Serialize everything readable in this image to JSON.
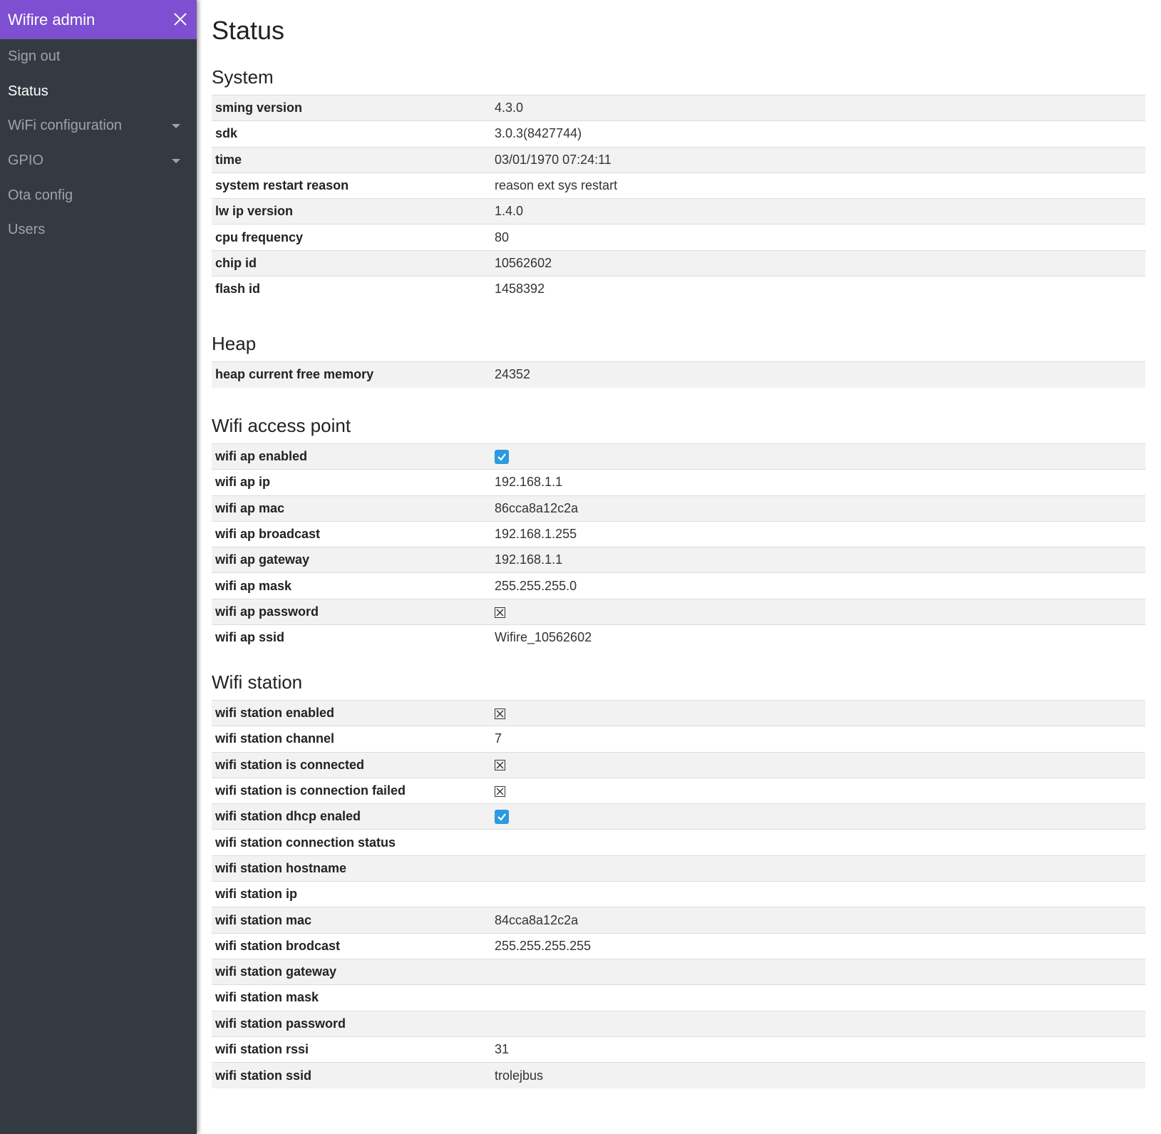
{
  "sidebar": {
    "title": "Wifire admin",
    "items": [
      {
        "label": "Sign out",
        "active": false,
        "has_caret": false
      },
      {
        "label": "Status",
        "active": true,
        "has_caret": false
      },
      {
        "label": "WiFi configuration",
        "active": false,
        "has_caret": true
      },
      {
        "label": "GPIO",
        "active": false,
        "has_caret": true
      },
      {
        "label": "Ota config",
        "active": false,
        "has_caret": false
      },
      {
        "label": "Users",
        "active": false,
        "has_caret": false
      }
    ]
  },
  "colors": {
    "header_accent": "#7e4fd0",
    "sidebar_bg": "#333a41",
    "check_yes": "#2b9ae0"
  },
  "page": {
    "title": "Status"
  },
  "sections": [
    {
      "title": "System",
      "rows": [
        {
          "key": "sming version",
          "value": "4.3.0"
        },
        {
          "key": "sdk",
          "value": "3.0.3(8427744)"
        },
        {
          "key": "time",
          "value": "03/01/1970 07:24:11"
        },
        {
          "key": "system restart reason",
          "value": "reason ext sys restart"
        },
        {
          "key": "lw ip version",
          "value": "1.4.0"
        },
        {
          "key": "cpu frequency",
          "value": "80"
        },
        {
          "key": "chip id",
          "value": "10562602"
        },
        {
          "key": "flash id",
          "value": "1458392"
        }
      ]
    },
    {
      "title": "Heap",
      "rows": [
        {
          "key": "heap current free memory",
          "value": "24352"
        }
      ]
    },
    {
      "title": "Wifi access point",
      "rows": [
        {
          "key": "wifi ap enabled",
          "bool": true
        },
        {
          "key": "wifi ap ip",
          "value": "192.168.1.1"
        },
        {
          "key": "wifi ap mac",
          "value": "86cca8a12c2a"
        },
        {
          "key": "wifi ap broadcast",
          "value": "192.168.1.255"
        },
        {
          "key": "wifi ap gateway",
          "value": "192.168.1.1"
        },
        {
          "key": "wifi ap mask",
          "value": "255.255.255.0"
        },
        {
          "key": "wifi ap password",
          "bool": false
        },
        {
          "key": "wifi ap ssid",
          "value": "Wifire_10562602"
        }
      ]
    },
    {
      "title": "Wifi station",
      "rows": [
        {
          "key": "wifi station enabled",
          "bool": false
        },
        {
          "key": "wifi station channel",
          "value": "7"
        },
        {
          "key": "wifi station is connected",
          "bool": false
        },
        {
          "key": "wifi station is connection failed",
          "bool": false
        },
        {
          "key": "wifi station dhcp enaled",
          "bool": true
        },
        {
          "key": "wifi station connection status",
          "value": ""
        },
        {
          "key": "wifi station hostname",
          "value": ""
        },
        {
          "key": "wifi station ip",
          "value": ""
        },
        {
          "key": "wifi station mac",
          "value": "84cca8a12c2a"
        },
        {
          "key": "wifi station brodcast",
          "value": "255.255.255.255"
        },
        {
          "key": "wifi station gateway",
          "value": ""
        },
        {
          "key": "wifi station mask",
          "value": ""
        },
        {
          "key": "wifi station password",
          "value": ""
        },
        {
          "key": "wifi station rssi",
          "value": "31"
        },
        {
          "key": "wifi station ssid",
          "value": "trolejbus"
        }
      ]
    }
  ]
}
